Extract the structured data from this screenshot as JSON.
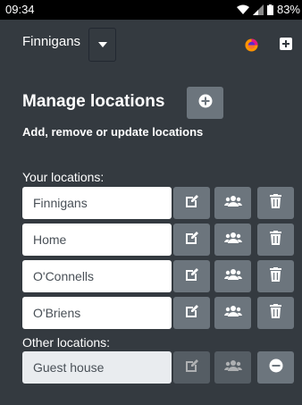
{
  "status_bar": {
    "time": "09:34",
    "battery": "83%"
  },
  "top_bar": {
    "current_location": "Finnigans"
  },
  "page": {
    "title": "Manage locations",
    "subtitle": "Add, remove or update locations",
    "your_locations_label": "Your locations:",
    "other_locations_label": "Other locations:"
  },
  "your_locations": [
    {
      "name": "Finnigans"
    },
    {
      "name": "Home"
    },
    {
      "name": "O'Connells"
    },
    {
      "name": "O'Briens"
    }
  ],
  "other_locations": [
    {
      "name": "Guest house"
    }
  ],
  "icons": {
    "edit": "edit-icon",
    "users": "users-icon",
    "delete": "trash-icon",
    "remove": "minus-circle-icon",
    "add": "plus-circle-icon"
  }
}
